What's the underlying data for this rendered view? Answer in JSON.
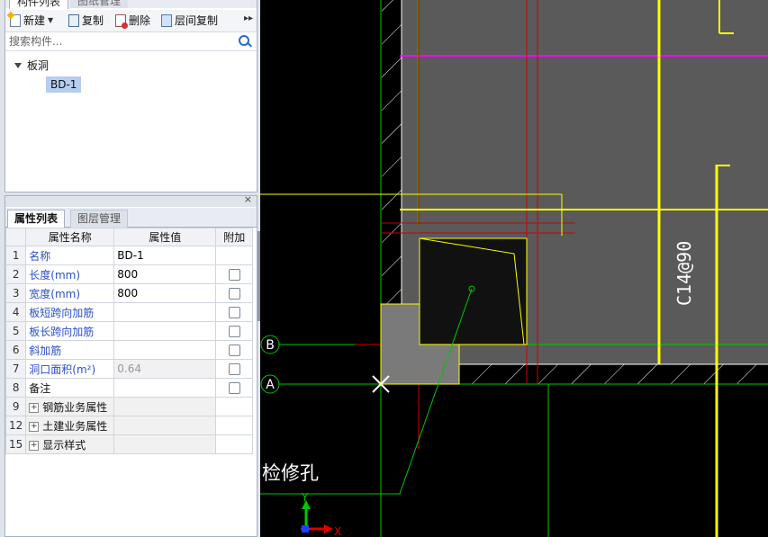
{
  "component_panel": {
    "tabs": [
      "构件列表",
      "图纸管理"
    ],
    "toolbar": {
      "new_label": "新建",
      "copy_label": "复制",
      "delete_label": "删除",
      "floor_copy_label": "层间复制"
    },
    "search_placeholder": "搜索构件...",
    "tree": {
      "root": "板洞",
      "child": "BD-1"
    }
  },
  "property_panel": {
    "tabs": [
      "属性列表",
      "图层管理"
    ],
    "headers": {
      "name": "属性名称",
      "value": "属性值",
      "extra": "附加"
    },
    "rows": [
      {
        "num": "1",
        "name": "名称",
        "value": "BD-1"
      },
      {
        "num": "2",
        "name": "长度(mm)",
        "value": "800"
      },
      {
        "num": "3",
        "name": "宽度(mm)",
        "value": "800"
      },
      {
        "num": "4",
        "name": "板短跨向加筋",
        "value": ""
      },
      {
        "num": "5",
        "name": "板长跨向加筋",
        "value": ""
      },
      {
        "num": "6",
        "name": "斜加筋",
        "value": ""
      },
      {
        "num": "7",
        "name": "洞口面积(m²)",
        "value": "0.64"
      },
      {
        "num": "8",
        "name": "备注",
        "value": ""
      },
      {
        "num": "9",
        "name": "钢筋业务属性",
        "value": ""
      },
      {
        "num": "12",
        "name": "土建业务属性",
        "value": ""
      },
      {
        "num": "15",
        "name": "显示样式",
        "value": ""
      }
    ]
  },
  "canvas": {
    "axis_b": "B",
    "axis_a": "A",
    "annotation": "检修孔",
    "rebar_label": "C14@90",
    "axis_x": "X",
    "axis_y": "Y",
    "colors": {
      "background": "#000000",
      "slab": "#5a5a5a",
      "axis_line": "#00c800",
      "beam": "#ffff00",
      "red_line": "#d00000",
      "magenta_line": "#ff00ff"
    }
  }
}
